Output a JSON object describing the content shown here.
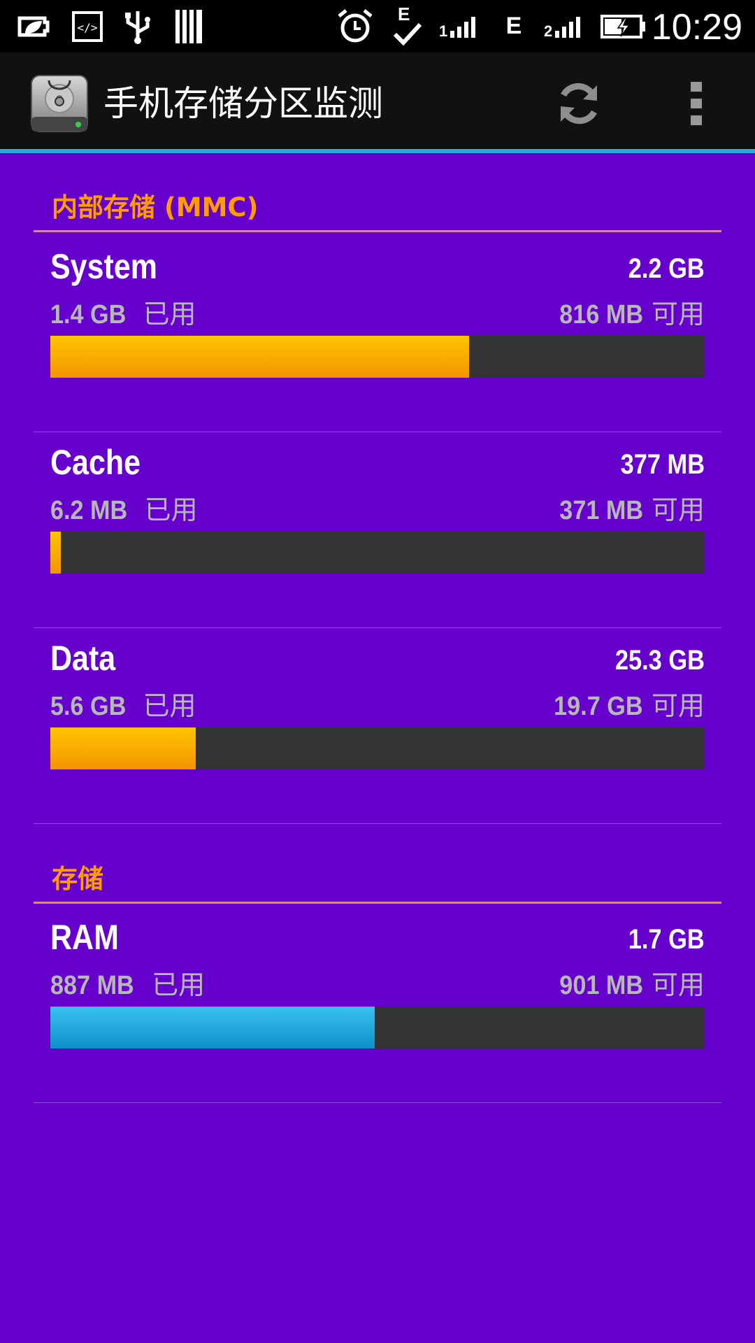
{
  "status_bar": {
    "time": "10:29",
    "icons": [
      "battery-saver-icon",
      "developer-code-icon",
      "usb-icon",
      "barcode-icon",
      "alarm-icon",
      "edge-check-icon",
      "signal-1-icon",
      "edge-e-icon",
      "signal-2-icon",
      "battery-charging-icon"
    ],
    "net_label_1": "E",
    "net_label_2": "E",
    "signal_label_1": "1",
    "signal_label_2": "2"
  },
  "action_bar": {
    "title": "手机存储分区监测",
    "app_icon": "disk-stethoscope-icon",
    "refresh_icon": "refresh-icon",
    "menu_icon": "overflow-menu-icon",
    "accent_color": "#2aa8e0"
  },
  "sections": [
    {
      "title": "内部存储 (MMC)",
      "items": [
        {
          "name": "System",
          "total": "2.2 GB",
          "used_value": "1.4 GB",
          "used_label": "已用",
          "free_value": "816 MB",
          "free_label": "可用",
          "fill_fraction": 0.64,
          "fill_color": "orange"
        },
        {
          "name": "Cache",
          "total": "377 MB",
          "used_value": "6.2 MB",
          "used_label": "已用",
          "free_value": "371 MB",
          "free_label": "可用",
          "fill_fraction": 0.016,
          "fill_color": "orange"
        },
        {
          "name": "Data",
          "total": "25.3 GB",
          "used_value": "5.6 GB",
          "used_label": "已用",
          "free_value": "19.7 GB",
          "free_label": "可用",
          "fill_fraction": 0.222,
          "fill_color": "orange"
        }
      ]
    },
    {
      "title": "存储",
      "items": [
        {
          "name": "RAM",
          "total": "1.7 GB",
          "used_value": "887 MB",
          "used_label": "已用",
          "free_value": "901 MB",
          "free_label": "可用",
          "fill_fraction": 0.496,
          "fill_color": "blue"
        }
      ]
    }
  ],
  "colors": {
    "background": "#6600cc",
    "section_title": "#ff9d00",
    "bar_track": "#333333",
    "bar_orange": "#ffb000",
    "bar_blue": "#1ca8dd"
  }
}
